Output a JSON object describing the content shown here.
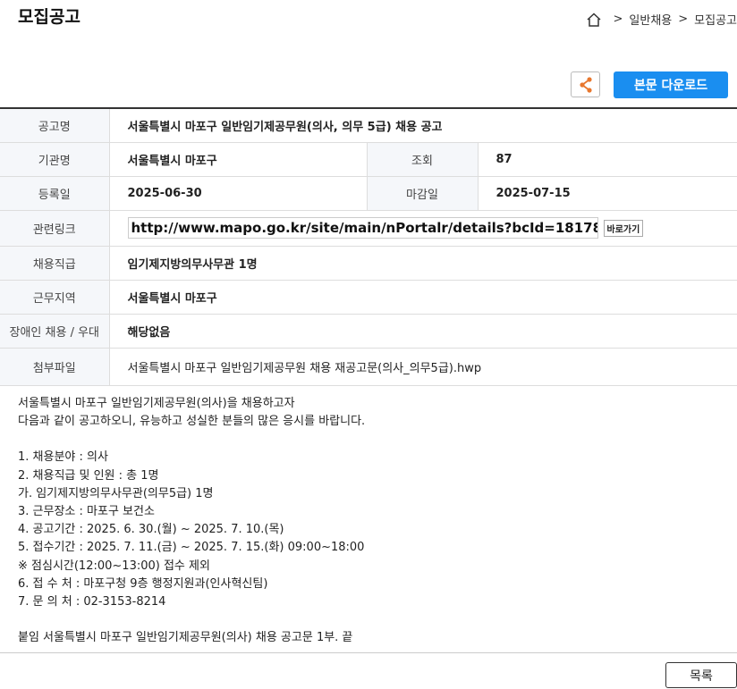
{
  "page_title": "모집공고",
  "breadcrumb": {
    "items": [
      "일반채용",
      "모집공고"
    ],
    "separator": ">"
  },
  "toolbar": {
    "download_label": "본문 다운로드"
  },
  "info": {
    "title_label": "공고명",
    "title_value": "서울특별시 마포구 일반임기제공무원(의사, 의무 5급) 채용 공고",
    "agency_label": "기관명",
    "agency_value": "서울특별시 마포구",
    "views_label": "조회",
    "views_value": "87",
    "reg_label": "등록일",
    "reg_value": "2025-06-30",
    "deadline_label": "마감일",
    "deadline_value": "2025-07-15",
    "link_label": "관련링크",
    "link_value": "http://www.mapo.go.kr/site/main/nPortalr/details?bcId=18178",
    "link_button": "바로가기",
    "position_label": "채용직급",
    "position_value": "임기제지방의무사무관 1명",
    "region_label": "근무지역",
    "region_value": "서울특별시 마포구",
    "disabled_label": "장애인 채용 / 우대",
    "disabled_value": "해당없음",
    "attach_label": "첨부파일",
    "attach_value": "서울특별시 마포구 일반임기제공무원 채용 재공고문(의사_의무5급).hwp"
  },
  "content_lines": [
    "서울특별시 마포구 일반임기제공무원(의사)을 채용하고자",
    "다음과 같이 공고하오니, 유능하고 성실한 분들의 많은 응시를 바랍니다.",
    "",
    "1. 채용분야 : 의사",
    "2. 채용직급 및 인원 : 총 1명",
    "가. 임기제지방의무사무관(의무5급) 1명",
    "3. 근무장소 : 마포구 보건소",
    "4. 공고기간 : 2025. 6. 30.(월) ~ 2025. 7. 10.(목)",
    "5. 접수기간 : 2025. 7. 11.(금) ~ 2025. 7. 15.(화) 09:00~18:00",
    "※ 점심시간(12:00~13:00) 접수 제외",
    "6. 접 수 처 : 마포구청 9층 행정지원과(인사혁신팀)",
    "7. 문 의 처 : 02-3153-8214",
    "",
    "붙임 서울특별시 마포구 일반임기제공무원(의사) 채용 공고문 1부. 끝"
  ],
  "footer": {
    "list_label": "목록"
  },
  "colors": {
    "accent": "#1a8ef0",
    "share_icon": "#e8772e",
    "label_bg": "#f5f7fa"
  },
  "icons": {
    "home": "home-icon",
    "share": "share-icon"
  }
}
